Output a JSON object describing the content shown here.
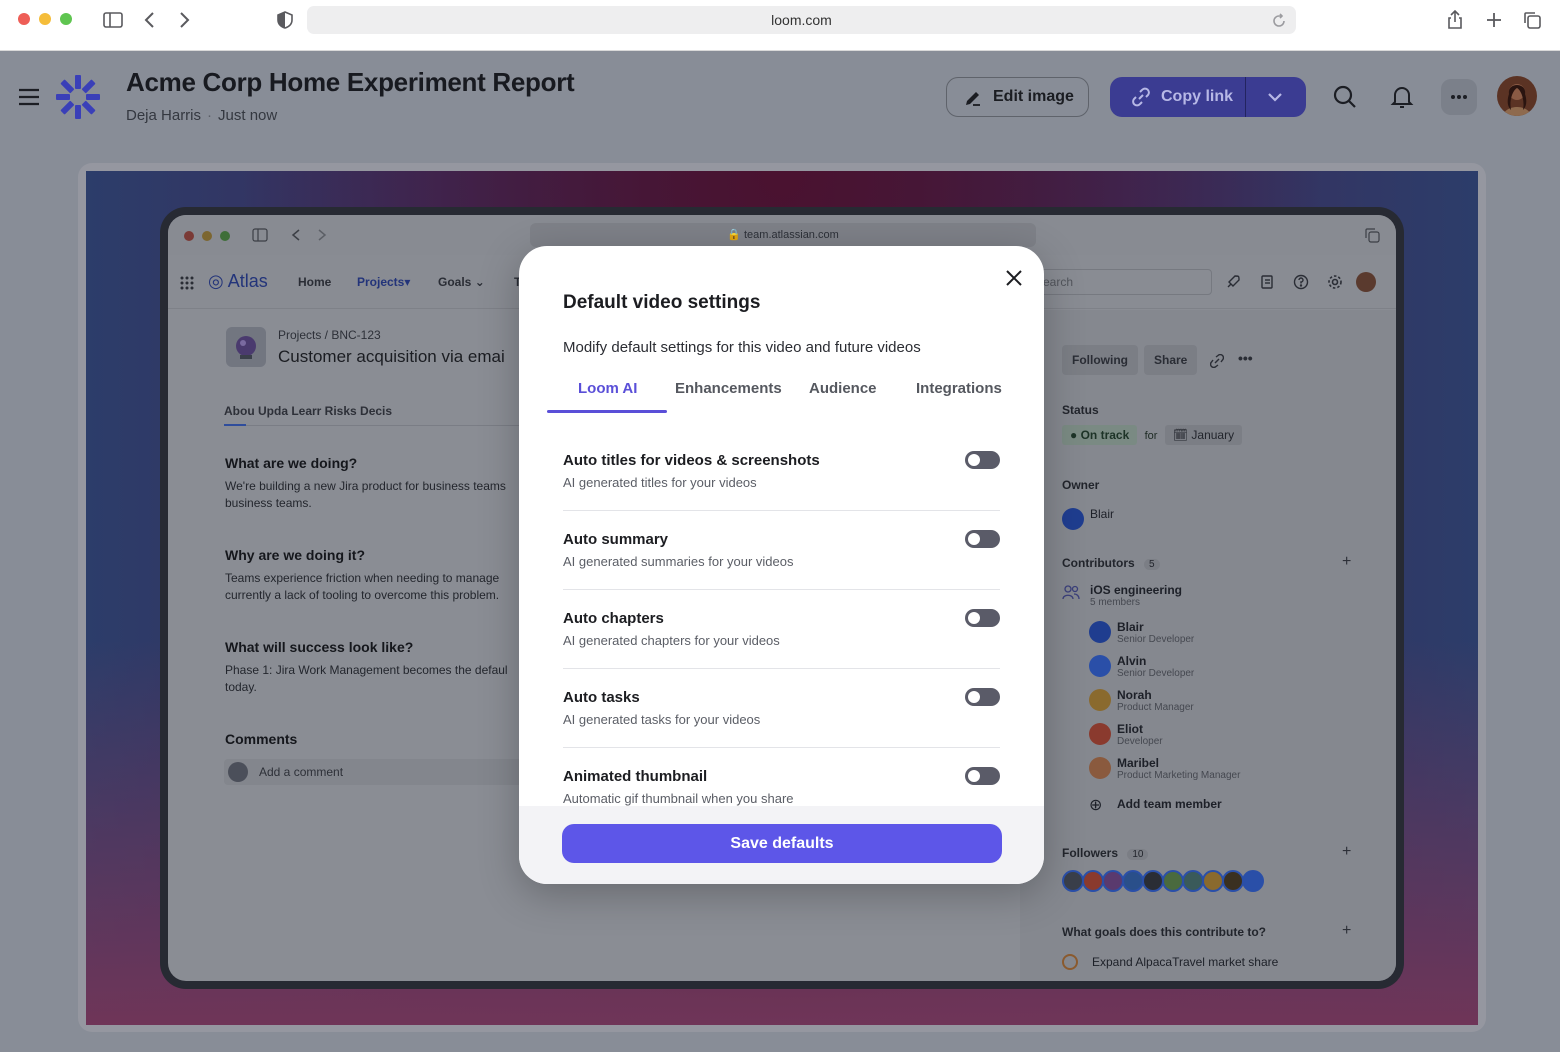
{
  "browser": {
    "url": "loom.com"
  },
  "header": {
    "title": "Acme Corp Home Experiment Report",
    "author": "Deja Harris",
    "separator": "·",
    "time": "Just now",
    "edit_label": "Edit image",
    "copy_label": "Copy link"
  },
  "screenshot": {
    "url": "team.atlassian.com",
    "app_name": "Atlas",
    "nav": [
      "Home",
      "Projects",
      "Goals",
      "T"
    ],
    "search_placeholder": "earch",
    "breadcrumb": "Projects  /  BNC-123",
    "project_title": "Customer acquisition via emai",
    "tabs": "Abou Upda Learr Risks Decis",
    "sections": [
      {
        "heading": "What are we doing?",
        "body": "We're building a new Jira product for business teams business teams."
      },
      {
        "heading": "Why are we doing it?",
        "body": "Teams experience friction when needing to manage currently a lack of tooling to overcome this problem."
      },
      {
        "heading": "What will success look like?",
        "body": "Phase 1: Jira Work Management becomes the defaul today."
      }
    ],
    "comments_heading": "Comments",
    "comment_placeholder": "Add a comment",
    "side": {
      "following": "Following",
      "share": "Share",
      "status_label": "Status",
      "status_value": "On track",
      "status_for": "for",
      "status_month": "January",
      "owner_label": "Owner",
      "owner_name": "Blair",
      "contributors_label": "Contributors",
      "contributors_count": "5",
      "team_name": "iOS engineering",
      "team_members": "5 members",
      "people": [
        {
          "name": "Blair",
          "role": "Senior Developer"
        },
        {
          "name": "Alvin",
          "role": "Senior Developer"
        },
        {
          "name": "Norah",
          "role": "Product Manager"
        },
        {
          "name": "Eliot",
          "role": "Developer"
        },
        {
          "name": "Maribel",
          "role": "Product Marketing Manager"
        }
      ],
      "add_member": "Add team member",
      "followers_label": "Followers",
      "followers_count": "10",
      "goals_label": "What goals does this contribute to?",
      "goal": "Expand AlpacaTravel market share"
    }
  },
  "modal": {
    "title": "Default video settings",
    "description": "Modify default settings for this video and future videos",
    "tabs": [
      "Loom AI",
      "Enhancements",
      "Audience",
      "Integrations"
    ],
    "active_tab": "Loom AI",
    "settings": [
      {
        "title": "Auto titles for videos & screenshots",
        "subtitle": "AI generated titles for your videos",
        "enabled": false
      },
      {
        "title": "Auto summary",
        "subtitle": "AI generated summaries for your videos",
        "enabled": false
      },
      {
        "title": "Auto chapters",
        "subtitle": "AI generated chapters for your videos",
        "enabled": false
      },
      {
        "title": "Auto tasks",
        "subtitle": "AI generated tasks for your videos",
        "enabled": false
      },
      {
        "title": "Animated thumbnail",
        "subtitle": "Automatic gif thumbnail when you share",
        "enabled": false
      }
    ],
    "save_label": "Save defaults"
  }
}
